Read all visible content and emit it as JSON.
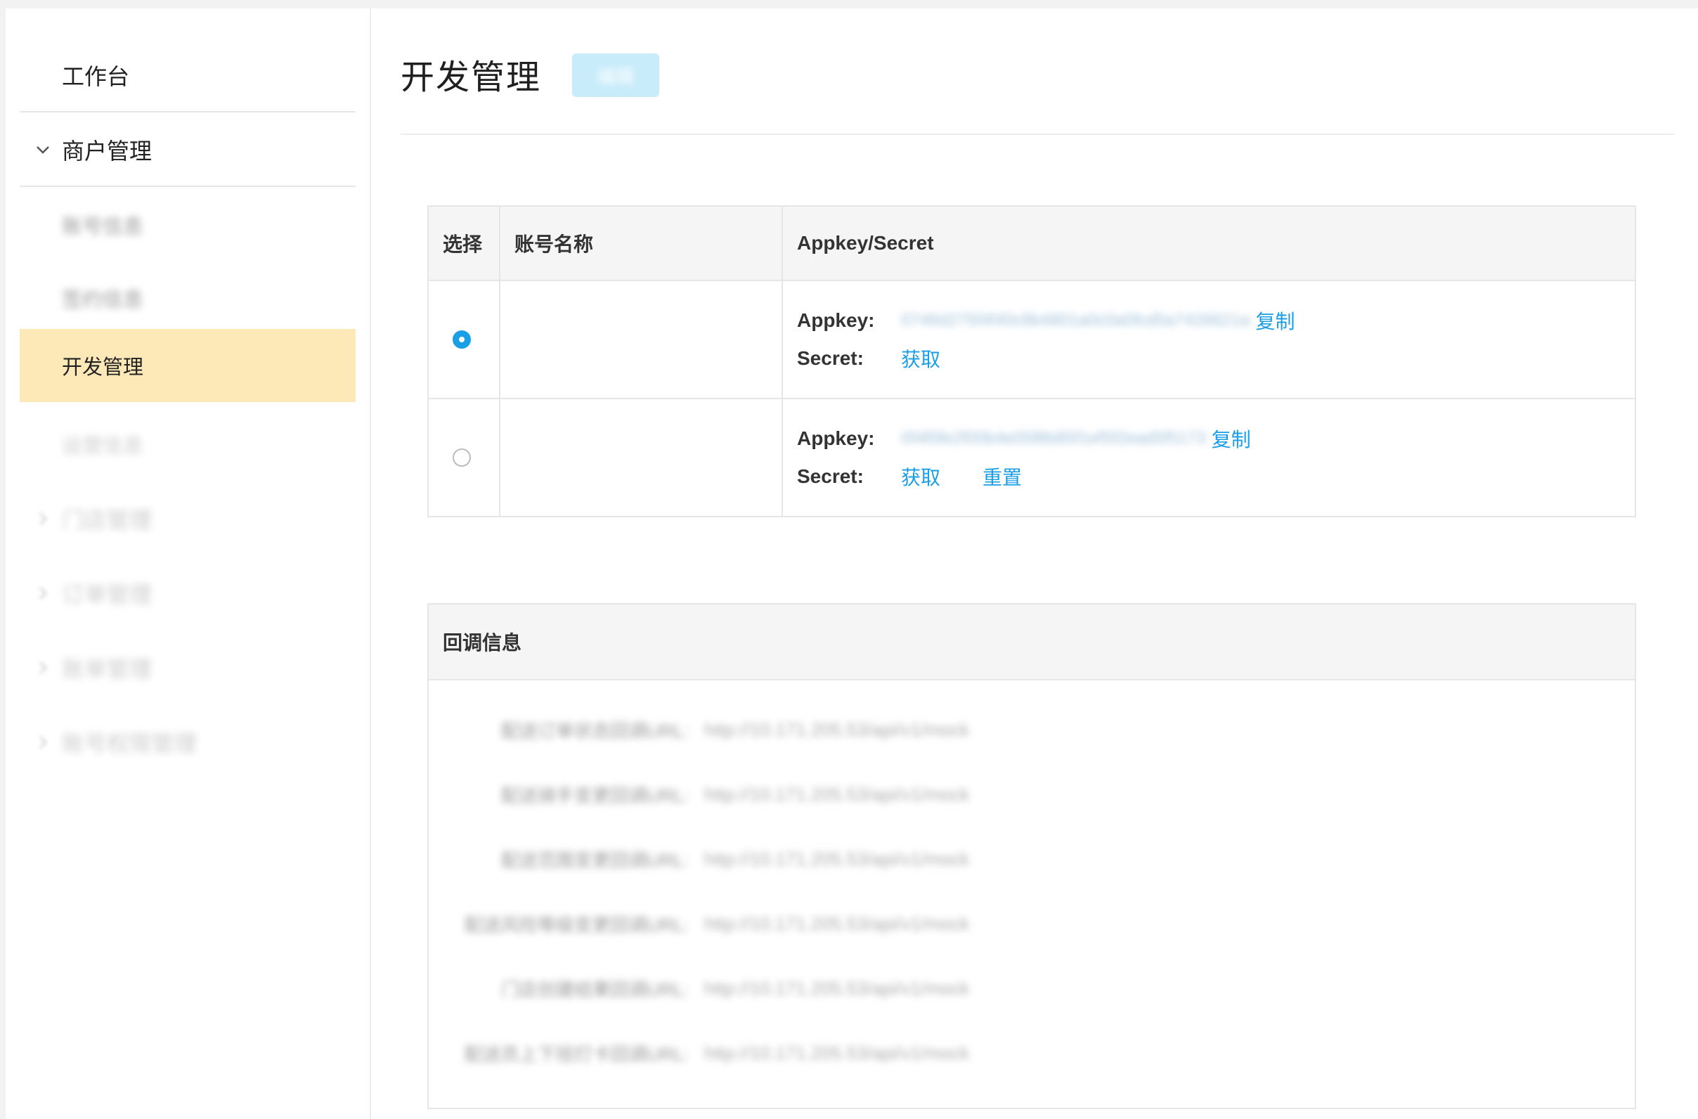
{
  "sidebar": {
    "workbench": "工作台",
    "merchant_group": "商户管理",
    "items": [
      {
        "label": "账号信息"
      },
      {
        "label": "签约信息"
      },
      {
        "label": "开发管理"
      },
      {
        "label": "运营信息"
      }
    ],
    "groups": [
      {
        "label": "门店管理"
      },
      {
        "label": "订单管理"
      },
      {
        "label": "账单管理"
      },
      {
        "label": "账号权限管理"
      }
    ]
  },
  "page": {
    "title": "开发管理",
    "action_button": "编辑"
  },
  "accounts_table": {
    "headers": [
      "选择",
      "账号名称",
      "Appkey/Secret"
    ],
    "appkey_label": "Appkey:",
    "secret_label": "Secret:",
    "copy_label": "复制",
    "fetch_label": "获取",
    "reset_label": "重置",
    "rows": [
      {
        "selected": true,
        "name": "",
        "appkey": "0746d275f4f40c8b4801a0c0a0fcd5a7426621a"
      },
      {
        "selected": false,
        "name": "",
        "appkey": "0f4f0fe2f00b4e05f8b85f1ef5f2ead5f5173"
      }
    ]
  },
  "callback": {
    "title": "回调信息",
    "rows": [
      {
        "label": "配送订单状态回调URL:",
        "url": "http://10.171.205.53/api/v1/mock"
      },
      {
        "label": "配送骑手变更回调URL:",
        "url": "http://10.171.205.53/api/v1/mock"
      },
      {
        "label": "配送范围变更回调URL:",
        "url": "http://10.171.205.53/api/v1/mock"
      },
      {
        "label": "配送风险等级变更回调URL:",
        "url": "http://10.171.205.53/api/v1/mock"
      },
      {
        "label": "门店创建结果回调URL:",
        "url": "http://10.171.205.53/api/v1/mock"
      },
      {
        "label": "配送员上下班打卡回调URL:",
        "url": "http://10.171.205.53/api/v1/mock"
      }
    ]
  },
  "colors": {
    "accent": "#1a9ee6",
    "active_bg": "#fde8b8"
  }
}
